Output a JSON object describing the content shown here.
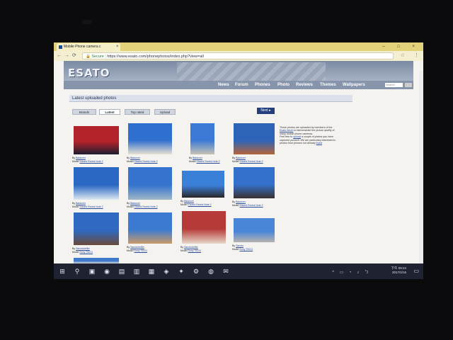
{
  "browser": {
    "tab_title": "Mobile Phone camera c",
    "tab_close": "×",
    "window_controls": "– □ ×",
    "back": "←",
    "forward": "→",
    "reload": "⟳",
    "secure_label": "Secure",
    "url": "https://www.esato.com/phonephotos/index.php?view=all",
    "star": "☆",
    "menu": "⋮"
  },
  "site": {
    "logo": "ESATO",
    "nav": [
      "News",
      "Forum",
      "Phones",
      "Photo",
      "Reviews",
      "Themes",
      "Wallpapers"
    ],
    "search_placeholder": "Search"
  },
  "section": {
    "title": "Latest uploaded photos",
    "tabs": [
      "Brands",
      "Latest",
      "Top rated",
      "Upload"
    ],
    "active_tab": "Latest",
    "next_label": "Next"
  },
  "photos": [
    {
      "by": "By",
      "author": "Balancer",
      "model_prefix": "Model",
      "model": "Xiaomi Redmi Note 2",
      "colors": [
        "#b2222a",
        "#1c1e30"
      ]
    },
    {
      "by": "By",
      "author": "Balancer",
      "model_prefix": "Model",
      "model": "Xiaomi Redmi Note 2",
      "colors": [
        "#2f6fd0",
        "#e9e1d0"
      ]
    },
    {
      "by": "By",
      "author": "Balancer",
      "model_prefix": "Model",
      "model": "Xiaomi Redmi Note 2",
      "colors": [
        "#3b7ad6",
        "#c8c2b4"
      ]
    },
    {
      "by": "By",
      "author": "Balancer",
      "model_prefix": "Model",
      "model": "Xiaomi Redmi Note 2",
      "colors": [
        "#2d64b8",
        "#b5653a"
      ]
    },
    {
      "by": "By",
      "author": "Balancer",
      "model_prefix": "Model",
      "model": "Xiaomi Redmi Note 2",
      "colors": [
        "#2b68c4",
        "#dfe8ef"
      ]
    },
    {
      "by": "By",
      "author": "Balancer",
      "model_prefix": "Model",
      "model": "Xiaomi Redmi Note 2",
      "colors": [
        "#3474cf",
        "#9fb6c6"
      ]
    },
    {
      "by": "By",
      "author": "Balancer",
      "model_prefix": "Model",
      "model": "Xiaomi Redmi Note 2",
      "colors": [
        "#3a7fd8",
        "#2a2626"
      ]
    },
    {
      "by": "By",
      "author": "Balancer",
      "model_prefix": "Model",
      "model": "Xiaomi Redmi Note 2",
      "colors": [
        "#3371cc",
        "#3a3030"
      ]
    },
    {
      "by": "By",
      "author": "Sanctuheffer",
      "model_prefix": "Model",
      "model": "Sony T8211",
      "colors": [
        "#2f69c2",
        "#6a4a3a"
      ]
    },
    {
      "by": "By",
      "author": "Sanctuheffer",
      "model_prefix": "Model",
      "model": "Sony T8211",
      "colors": [
        "#3b7ad0",
        "#c99b6a"
      ]
    },
    {
      "by": "By",
      "author": "Sanctuheffer",
      "model_prefix": "Model",
      "model": "Sony T8211",
      "colors": [
        "#b63a38",
        "#e6d8c8"
      ]
    },
    {
      "by": "By",
      "author": "Sanctu",
      "model_prefix": "Model",
      "model": "Sony T8211",
      "colors": [
        "#4a86d8",
        "#b8b4ae"
      ]
    },
    {
      "by": "",
      "author": "",
      "model_prefix": "",
      "model": "",
      "colors": [
        "#3d79cc",
        "#dcdcdc"
      ]
    }
  ],
  "sidebar": {
    "line1": "These photos are uploaded by members of the",
    "line2_link": "Esato forum",
    "line2_rest": " to demonstrate the picture quality of",
    "line3": "many mobile phone cameras.",
    "line4_pre": "Feel free to ",
    "line4_link": "upload",
    "line4_post": " a couple of photos you have",
    "line5": "captured yourself. We are particulary interested in",
    "line6_pre": "photos from phones not already ",
    "line6_link": "listed"
  },
  "taskbar": {
    "icons": [
      "start-icon",
      "search-icon",
      "task-view-icon",
      "chrome-icon",
      "app-icon",
      "explorer-icon",
      "store-icon",
      "media-icon",
      "game-icon",
      "settings-icon",
      "network-icon",
      "mail-icon"
    ],
    "time": "下午 09:24",
    "date": "2017/2/16",
    "tray": "^ ▭ ◔ ♪ ㄅ"
  }
}
